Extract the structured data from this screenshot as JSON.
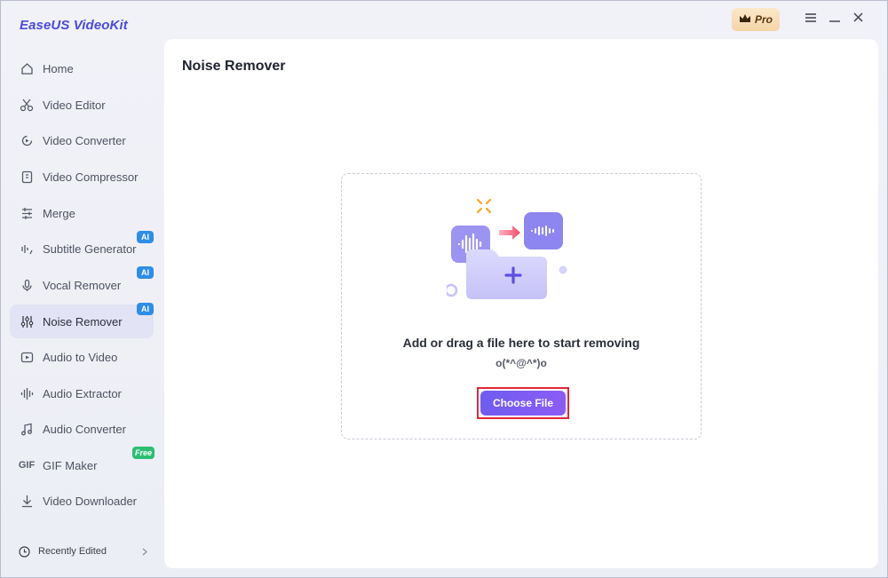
{
  "app": {
    "title": "EaseUS VideoKit",
    "pro_label": "Pro"
  },
  "sidebar": {
    "items": [
      {
        "label": "Home",
        "icon": "home-icon"
      },
      {
        "label": "Video Editor",
        "icon": "scissors-icon"
      },
      {
        "label": "Video Converter",
        "icon": "convert-icon"
      },
      {
        "label": "Video Compressor",
        "icon": "compress-icon"
      },
      {
        "label": "Merge",
        "icon": "merge-icon"
      },
      {
        "label": "Subtitle Generator",
        "icon": "subtitle-icon",
        "tag": "AI"
      },
      {
        "label": "Vocal Remover",
        "icon": "microphone-icon",
        "tag": "AI"
      },
      {
        "label": "Noise Remover",
        "icon": "equalizer-icon",
        "tag": "AI",
        "active": true
      },
      {
        "label": "Audio to Video",
        "icon": "play-box-icon"
      },
      {
        "label": "Audio Extractor",
        "icon": "waveform-icon"
      },
      {
        "label": "Audio Converter",
        "icon": "music-note-icon"
      },
      {
        "label": "GIF Maker",
        "icon": "gif-icon",
        "tag": "Free"
      },
      {
        "label": "Video Downloader",
        "icon": "download-icon"
      }
    ],
    "recently_edited": "Recently Edited"
  },
  "main": {
    "title": "Noise Remover",
    "drop_text": "Add or drag a file here to start removing",
    "drop_sub": "o(*^@^*)o",
    "choose_label": "Choose File"
  },
  "colors": {
    "accent": "#6f5cf0",
    "brand_title": "#4b4ae0",
    "ai_tag": "#2e8de6",
    "free_tag": "#2cbf73",
    "highlight": "#e0283a"
  }
}
